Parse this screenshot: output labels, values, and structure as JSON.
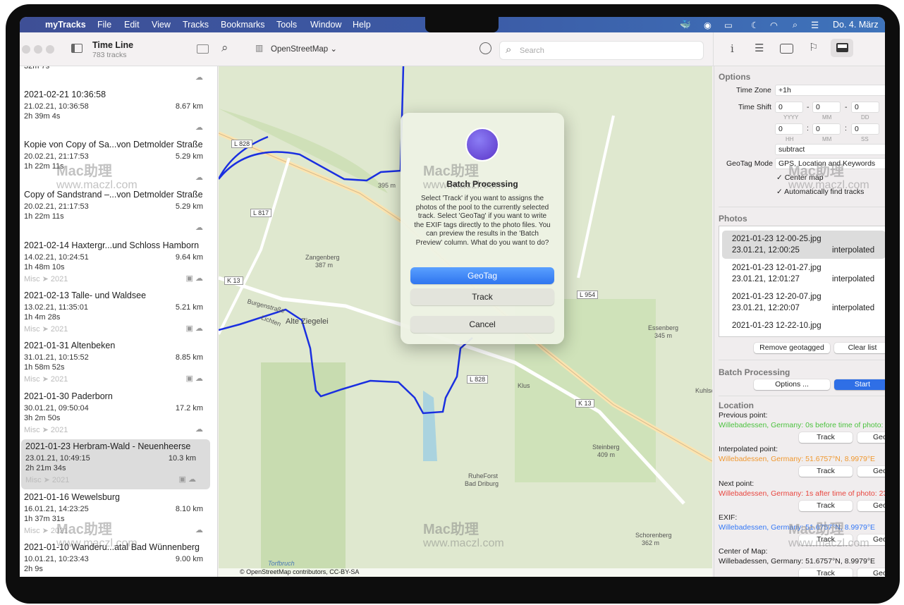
{
  "menubar": {
    "app": "myTracks",
    "items": [
      "File",
      "Edit",
      "View",
      "Tracks",
      "Bookmarks",
      "Tools",
      "Window",
      "Help"
    ],
    "clock": "Do. 4. März"
  },
  "toolbar": {
    "title": "Time Line",
    "subtitle": "783 tracks",
    "map_style": "OpenStreetMap",
    "search_placeholder": "Search"
  },
  "tracks": [
    {
      "title": "",
      "date": "",
      "distance": "",
      "duration": "32m 7s",
      "category": "",
      "photo": false
    },
    {
      "title": "2021-02-21 10:36:58",
      "date": "21.02.21, 10:36:58",
      "distance": "8.67 km",
      "duration": "2h 39m 4s",
      "category": "",
      "photo": false
    },
    {
      "title": "Kopie von Copy of Sa...von Detmolder Straße",
      "date": "20.02.21, 21:17:53",
      "distance": "5.29 km",
      "duration": "1h 22m 11s",
      "category": "",
      "photo": false
    },
    {
      "title": "Copy of Sandstrand –...von Detmolder Straße",
      "date": "20.02.21, 21:17:53",
      "distance": "5.29 km",
      "duration": "1h 22m 11s",
      "category": "",
      "photo": false
    },
    {
      "title": "2021-02-14 Haxtergr...und Schloss Hamborn",
      "date": "14.02.21, 10:24:51",
      "distance": "9.64 km",
      "duration": "1h 48m 10s",
      "category": "Misc ➤ 2021",
      "photo": true
    },
    {
      "title": "2021-02-13 Talle- und Waldsee",
      "date": "13.02.21, 11:35:01",
      "distance": "5.21 km",
      "duration": "1h 4m 28s",
      "category": "Misc ➤ 2021",
      "photo": true
    },
    {
      "title": "2021-01-31 Altenbeken",
      "date": "31.01.21, 10:15:52",
      "distance": "8.85 km",
      "duration": "1h 58m 52s",
      "category": "Misc ➤ 2021",
      "photo": true
    },
    {
      "title": "2021-01-30 Paderborn",
      "date": "30.01.21, 09:50:04",
      "distance": "17.2 km",
      "duration": "3h 2m 50s",
      "category": "Misc ➤ 2021",
      "photo": false
    },
    {
      "title": "2021-01-23 Herbram-Wald - Neuenheerse",
      "date": "23.01.21, 10:49:15",
      "distance": "10.3 km",
      "duration": "2h 21m 34s",
      "category": "Misc ➤ 2021",
      "photo": true,
      "selected": true
    },
    {
      "title": "2021-01-16 Wewelsburg",
      "date": "16.01.21, 14:23:25",
      "distance": "8.10 km",
      "duration": "1h 37m 31s",
      "category": "Misc ➤ 2021",
      "photo": false
    },
    {
      "title": "2021-01-10 Wanderu...atal Bad Wünnenberg",
      "date": "10.01.21, 10:23:43",
      "distance": "9.00 km",
      "duration": "2h 9s",
      "category": "",
      "photo": false
    }
  ],
  "map": {
    "labels": [
      "L 828",
      "L 817",
      "K 13",
      "Burgenstraße",
      "Alte Ziegelei",
      "Lichten",
      "Zangenberg",
      "387 m",
      "395 m",
      "L 954",
      "Essenberg",
      "345 m",
      "L 828",
      "K 13",
      "Steinberg",
      "409 m",
      "RuheForst",
      "Bad Driburg",
      "Schorenberg",
      "362 m",
      "Torfbruch",
      "Kuhlse",
      "Klus"
    ],
    "attribution": "© OpenStreetMap contributors, CC-BY-SA",
    "route_color": "#1a2fe0"
  },
  "dialog": {
    "title": "Batch Processing",
    "message": "Select 'Track' if you want to assigns the photos of the pool to the currently selected track. Select 'GeoTag' if you want to write the EXIF tags directly to the photo files. You can preview the results in the 'Batch Preview' column. What do you want to do?",
    "geotag": "GeoTag",
    "track": "Track",
    "cancel": "Cancel"
  },
  "panel": {
    "options": {
      "heading": "Options",
      "time_zone_label": "Time Zone",
      "time_zone": "+1h",
      "time_shift_label": "Time Shift",
      "yyyy": "0",
      "mm": "0",
      "dd": "0",
      "hh": "0",
      "min": "0",
      "ss": "0",
      "yyyy_l": "YYYY",
      "mm_l": "MM",
      "dd_l": "DD",
      "hh_l": "HH",
      "min_l": "MM",
      "ss_l": "SS",
      "direction": "subtract",
      "geotag_mode_label": "GeoTag Mode",
      "geotag_mode": "GPS, Location and Keywords",
      "center_map": "Center map",
      "auto_find": "Automatically find tracks"
    },
    "photos": {
      "heading": "Photos",
      "items": [
        {
          "name": "2021-01-23 12-00-25.jpg",
          "date": "23.01.21, 12:00:25",
          "status": "interpolated"
        },
        {
          "name": "2021-01-23 12-01-27.jpg",
          "date": "23.01.21, 12:01:27",
          "status": "interpolated"
        },
        {
          "name": "2021-01-23 12-20-07.jpg",
          "date": "23.01.21, 12:20:07",
          "status": "interpolated"
        },
        {
          "name": "2021-01-23 12-22-10.jpg",
          "date": "",
          "status": ""
        }
      ],
      "remove": "Remove geotagged",
      "clear": "Clear list"
    },
    "batch": {
      "heading": "Batch Processing",
      "options": "Options ...",
      "start": "Start"
    },
    "location": {
      "heading": "Location",
      "track": "Track",
      "geo": "Geo",
      "points": [
        {
          "label": "Previous point:",
          "value": "Willebadessen, Germany: 0s before time of photo:",
          "color": "#4cc23f"
        },
        {
          "label": "Interpolated point:",
          "value": "Willebadessen, Germany: 51.6757°N, 8.9979°E",
          "color": "#f0982f"
        },
        {
          "label": "Next point:",
          "value": "Willebadessen, Germany: 1s after time of photo: 23",
          "color": "#e8463f"
        },
        {
          "label": "EXIF:",
          "value": "Willebadessen, Germany: 51.6757°N, 8.9979°E",
          "color": "#3478f6"
        },
        {
          "label": "Center of Map:",
          "value": "Willebadessen, Germany: 51.6757°N, 8.9979°E",
          "color": "#222222"
        }
      ]
    }
  },
  "watermark": {
    "cn": "Mac助理",
    "url": "www.maczl.com"
  }
}
